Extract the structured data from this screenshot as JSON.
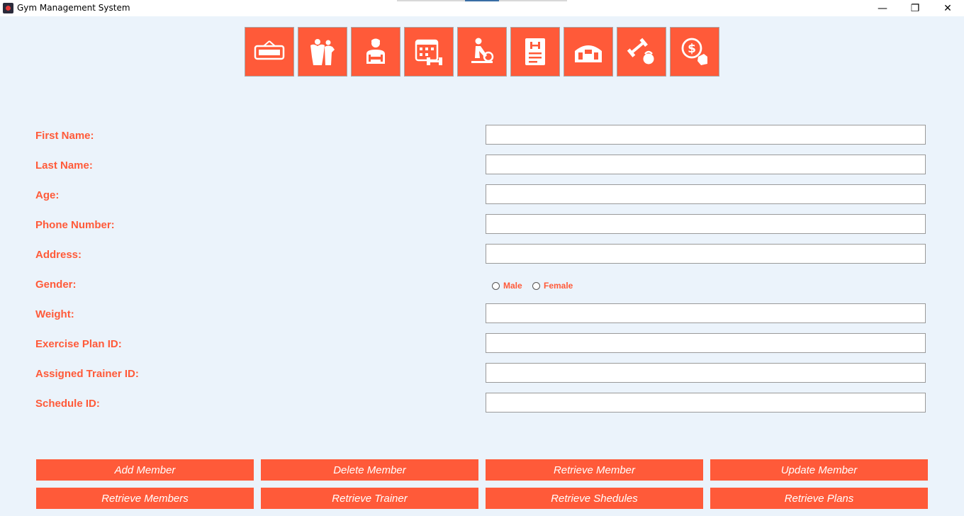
{
  "window": {
    "title": "Gym Management System",
    "controls": {
      "minimize": "—",
      "restore": "❐",
      "close": "✕"
    }
  },
  "colors": {
    "accent": "#ff5a39",
    "background": "#ebf3fb",
    "tile_border": "#a8a8a8"
  },
  "toolbar": {
    "items": [
      {
        "icon": "welcome-sign-icon"
      },
      {
        "icon": "bodybuilders-icon"
      },
      {
        "icon": "trainer-icon"
      },
      {
        "icon": "schedule-calendar-icon"
      },
      {
        "icon": "exercise-icon"
      },
      {
        "icon": "plan-document-icon"
      },
      {
        "icon": "gym-building-icon"
      },
      {
        "icon": "equipment-icon"
      },
      {
        "icon": "payment-icon"
      }
    ]
  },
  "form": {
    "first_name": {
      "label": "First Name:",
      "value": ""
    },
    "last_name": {
      "label": "Last Name:",
      "value": ""
    },
    "age": {
      "label": "Age:",
      "value": ""
    },
    "phone": {
      "label": "Phone Number:",
      "value": ""
    },
    "address": {
      "label": "Address:",
      "value": ""
    },
    "gender": {
      "label": "Gender:",
      "options": [
        "Male",
        "Female"
      ],
      "selected": ""
    },
    "weight": {
      "label": "Weight:",
      "value": ""
    },
    "exercise_plan_id": {
      "label": "Exercise Plan ID:",
      "value": ""
    },
    "trainer_id": {
      "label": "Assigned Trainer ID:",
      "value": ""
    },
    "schedule_id": {
      "label": "Schedule ID:",
      "value": ""
    }
  },
  "actions": {
    "add_member": "Add Member",
    "delete_member": "Delete Member",
    "retrieve_member": "Retrieve Member",
    "update_member": "Update Member",
    "retrieve_members": "Retrieve Members",
    "retrieve_trainer": "Retrieve Trainer",
    "retrieve_schedules": "Retrieve Shedules",
    "retrieve_plans": "Retrieve Plans"
  }
}
